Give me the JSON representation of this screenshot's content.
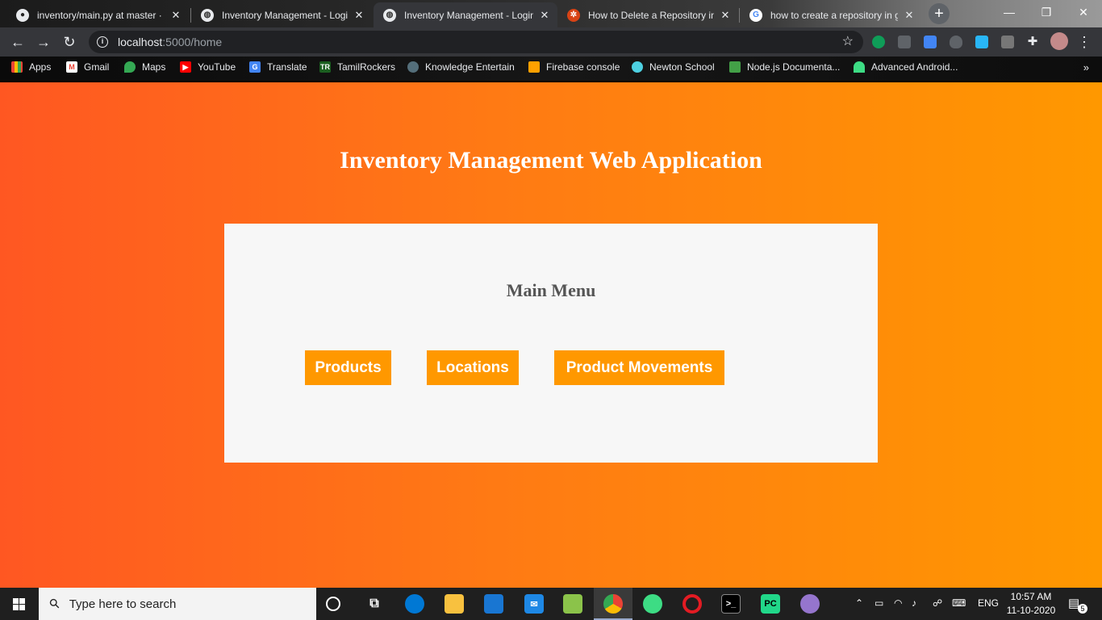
{
  "browser": {
    "tabs": [
      {
        "title": "inventory/main.py at master · M",
        "icon": "github-icon"
      },
      {
        "title": "Inventory Management - Login",
        "icon": "globe-icon"
      },
      {
        "title": "Inventory Management - Login",
        "icon": "globe-icon"
      },
      {
        "title": "How to Delete a Repository in G",
        "icon": "gear-favicon"
      },
      {
        "title": "how to create a repository in gi",
        "icon": "google-icon"
      }
    ],
    "url_host": "localhost",
    "url_path": ":5000/home"
  },
  "bookmarks": [
    {
      "label": "Apps",
      "icon": "apps-grid-icon"
    },
    {
      "label": "Gmail",
      "icon": "gmail-icon"
    },
    {
      "label": "Maps",
      "icon": "maps-icon"
    },
    {
      "label": "YouTube",
      "icon": "youtube-icon"
    },
    {
      "label": "Translate",
      "icon": "translate-icon"
    },
    {
      "label": "TamilRockers",
      "icon": "tr-icon"
    },
    {
      "label": "Knowledge Entertain",
      "icon": "knowledge-icon"
    },
    {
      "label": "Firebase console",
      "icon": "firebase-icon"
    },
    {
      "label": "Newton School",
      "icon": "newton-icon"
    },
    {
      "label": "Node.js Documenta...",
      "icon": "nodejs-icon"
    },
    {
      "label": "Advanced Android...",
      "icon": "android-icon"
    }
  ],
  "page": {
    "heading": "Inventory Management Web Application",
    "menu_title": "Main Menu",
    "buttons": [
      {
        "label": "Products"
      },
      {
        "label": "Locations"
      },
      {
        "label": "Product Movements"
      }
    ]
  },
  "taskbar": {
    "search_placeholder": "Type here to search",
    "language": "ENG",
    "time": "10:57 AM",
    "date": "11-10-2020",
    "notification_count": "5"
  },
  "colors": {
    "accent": "#ff9800",
    "gradient_start": "#ff5722",
    "card_bg": "#f7f7f7"
  }
}
